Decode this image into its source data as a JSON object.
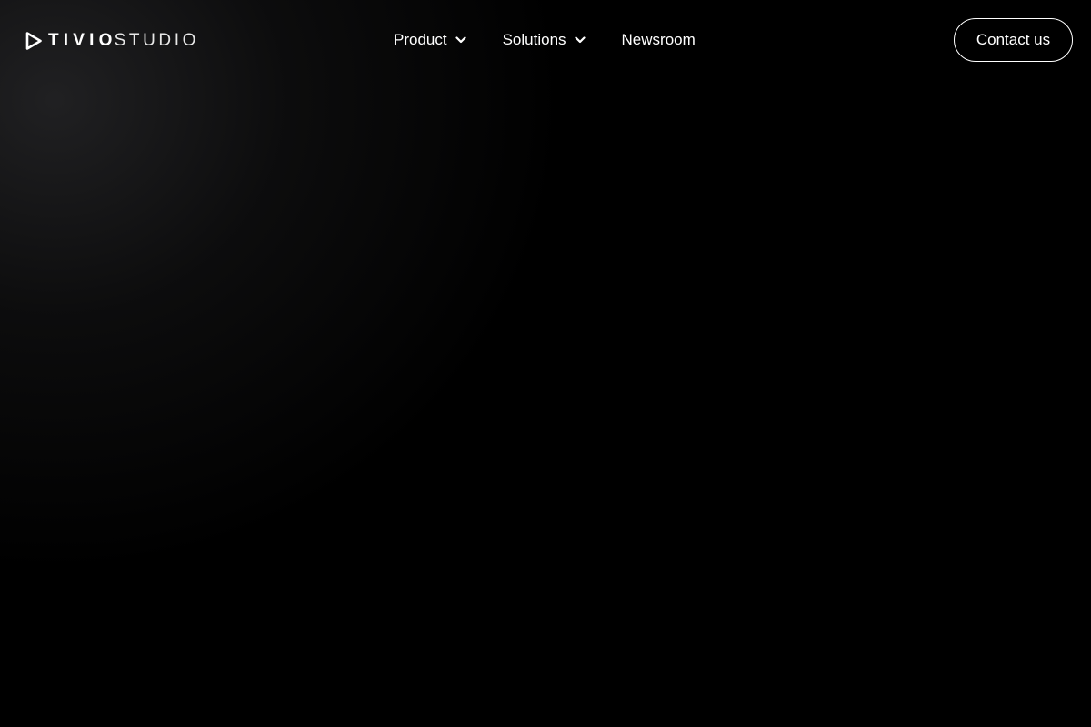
{
  "brand": {
    "name_bold": "TIVIO",
    "name_light": "STUDIO",
    "logo_icon": "play-triangle-icon"
  },
  "nav": {
    "items": [
      {
        "label": "Product",
        "has_dropdown": true,
        "icon": "chevron-down-icon"
      },
      {
        "label": "Solutions",
        "has_dropdown": true,
        "icon": "chevron-down-icon"
      },
      {
        "label": "Newsroom",
        "has_dropdown": false
      }
    ]
  },
  "cta": {
    "label": "Contact us"
  },
  "colors": {
    "background": "#000000",
    "text": "#ffffff",
    "button_border": "#ffffff"
  }
}
